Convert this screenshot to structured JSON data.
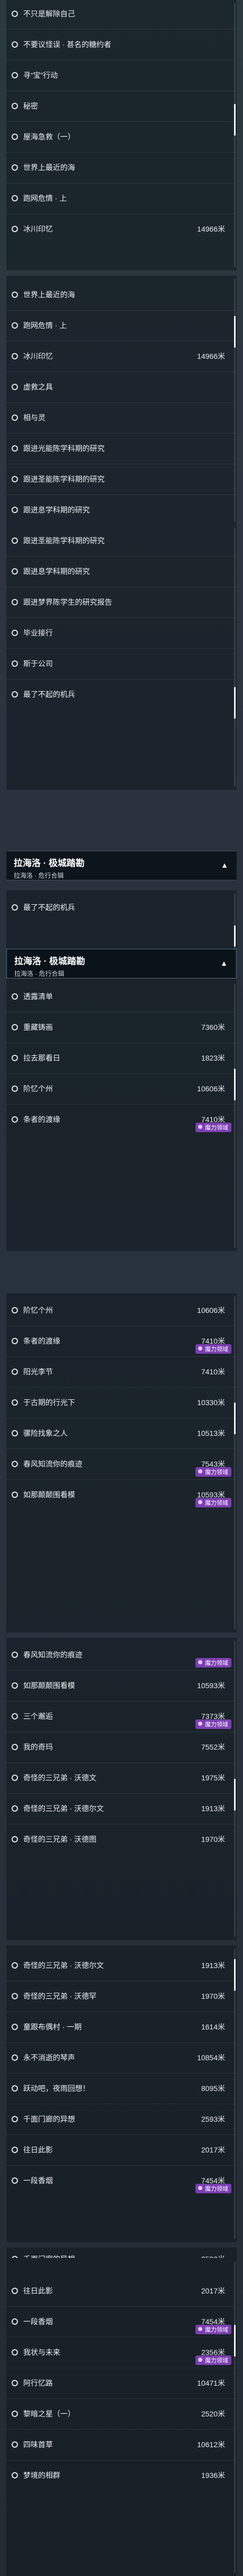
{
  "badge_label": "魔力领域",
  "section": {
    "title": "拉海洛 · 极城踏勘",
    "subtitle": "拉海洛 · 危行合辑"
  },
  "screens": [
    {
      "items": [
        {
          "name": "不只是解除自己"
        },
        {
          "name": "不要议怪误 · 甚名的糖约者"
        },
        {
          "name": "寻“宝”行动"
        },
        {
          "name": "秘密"
        },
        {
          "name": "屋海急救（一）"
        },
        {
          "name": "世界上最近的海"
        },
        {
          "name": "跑网危情 · 上"
        },
        {
          "name": "冰川印忆",
          "dist": "14966米"
        }
      ]
    },
    {
      "items": [
        {
          "name": "世界上最近的海"
        },
        {
          "name": "跑网危情 · 上"
        },
        {
          "name": "冰川印忆",
          "dist": "14966米"
        },
        {
          "name": "虚救之具"
        },
        {
          "name": "相与灵"
        },
        {
          "name": "跟进光能陈学科期的研究"
        },
        {
          "name": "跟进圣能陈学科期的研究"
        },
        {
          "name": "跟进息学科期的研究"
        }
      ]
    },
    {
      "items": [
        {
          "name": "跟进圣能陈学科期的研究"
        },
        {
          "name": "跟进息学科期的研究"
        },
        {
          "name": "跟进梦界陈学生的研究报告"
        },
        {
          "name": "毕业接行"
        },
        {
          "name": "斯于公司"
        },
        {
          "name": "最了不起的机兵"
        }
      ]
    },
    {
      "items": [
        {
          "name": "最了不起的机兵"
        }
      ]
    },
    {
      "items": [
        {
          "name": "透露清单"
        },
        {
          "name": "重藏铸画",
          "dist": "7360米"
        },
        {
          "name": "拉去那看日",
          "dist": "1823米"
        },
        {
          "name": "阶忆个州",
          "dist": "10606米"
        },
        {
          "name": "条者的渡缘",
          "dist": "7410米",
          "badge": true
        }
      ]
    },
    {
      "items": [
        {
          "name": "阶忆个州",
          "dist": "10606米"
        },
        {
          "name": "条者的渡缘",
          "dist": "7410米",
          "badge": true
        },
        {
          "name": "阳光李节",
          "dist": "7410米"
        },
        {
          "name": "于古期的行光下",
          "dist": "10330米"
        },
        {
          "name": "骡险找象之人",
          "dist": "10513米"
        },
        {
          "name": "春风知流你的痕迹",
          "dist": "7543米",
          "badge": true
        },
        {
          "name": "如那颠颠围看模",
          "dist": "10593米",
          "badge": true
        }
      ]
    },
    {
      "items": [
        {
          "name": "春风知流你的痕迹",
          "dist": "",
          "badge": true
        },
        {
          "name": "如那颠颠围看模",
          "dist": "10593米"
        },
        {
          "name": "三个邂逅",
          "dist": "7373米",
          "badge": true
        },
        {
          "name": "我的奇玛",
          "dist": "7552米"
        },
        {
          "name": "奇怪的三兄弟 · 沃德文",
          "dist": "1975米"
        },
        {
          "name": "奇怪的三兄弟 · 沃德尔文",
          "dist": "1913米"
        },
        {
          "name": "奇怪的三兄弟 · 沃德图",
          "dist": "1970米"
        }
      ]
    },
    {
      "items": [
        {
          "name": "奇怪的三兄弟 · 沃德尔文",
          "dist": "1913米"
        },
        {
          "name": "奇怪的三兄弟 · 沃德罕",
          "dist": "1970米"
        },
        {
          "name": "童跟布偶村 · 一期",
          "dist": "1614米"
        },
        {
          "name": "永不消逝的琴声",
          "dist": "10854米"
        },
        {
          "name": "跃动吧，夜雨回想！",
          "dist": "8095米"
        },
        {
          "name": "千面门廊的异想",
          "dist": "2593米"
        },
        {
          "name": "往日此影",
          "dist": "2017米"
        },
        {
          "name": "一段香烟",
          "dist": "7454米",
          "badge": true
        }
      ]
    },
    {
      "items": [
        {
          "name": "千面门廊的异想",
          "dist": "2593米"
        },
        {
          "name": "往日此影",
          "dist": "2017米"
        },
        {
          "name": "一段香烟",
          "dist": "7454米",
          "badge": true
        },
        {
          "name": "我状与未来",
          "dist": "2356米",
          "badge": true
        },
        {
          "name": "阿行忆路",
          "dist": "10471米"
        },
        {
          "name": "黎暗之星（一）",
          "dist": "2520米"
        },
        {
          "name": "四味首草",
          "dist": "10612米"
        },
        {
          "name": "梦境的相群",
          "dist": "1936米"
        }
      ]
    },
    {
      "items": [
        {
          "name": "往日此影",
          "dist": "2017米"
        },
        {
          "name": "一段香烟",
          "dist": "7454米",
          "badge": true
        },
        {
          "name": "我状与未来",
          "dist": "2356米",
          "badge": true
        },
        {
          "name": "阿行忆路",
          "dist": "10471米"
        },
        {
          "name": "黎暗之星（一）",
          "dist": "2520米"
        },
        {
          "name": "四味首草",
          "dist": "10612米"
        },
        {
          "name": "梦境的相群",
          "dist": "1936米"
        }
      ]
    }
  ]
}
